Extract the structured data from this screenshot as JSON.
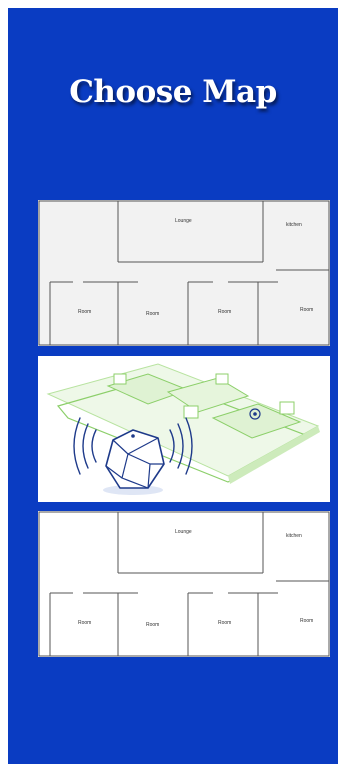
{
  "header": {
    "title": "Choose Map"
  },
  "maps": [
    {
      "labels": {
        "lounge": "Lounge",
        "kitchen": "kitchen",
        "room1": "Room",
        "room2": "Room",
        "room3": "Room",
        "room4": "Room"
      }
    },
    {
      "illustration": "beacon-smart-home-icon"
    },
    {
      "labels": {
        "lounge": "Lounge",
        "kitchen": "kitchen",
        "room1": "Room",
        "room2": "Room",
        "room3": "Room",
        "room4": "Room"
      }
    }
  ],
  "colors": {
    "background": "#0a3cc2",
    "title": "#ffffff",
    "accent_green": "#8ccf6a",
    "beacon_blue": "#1e3a8a"
  }
}
